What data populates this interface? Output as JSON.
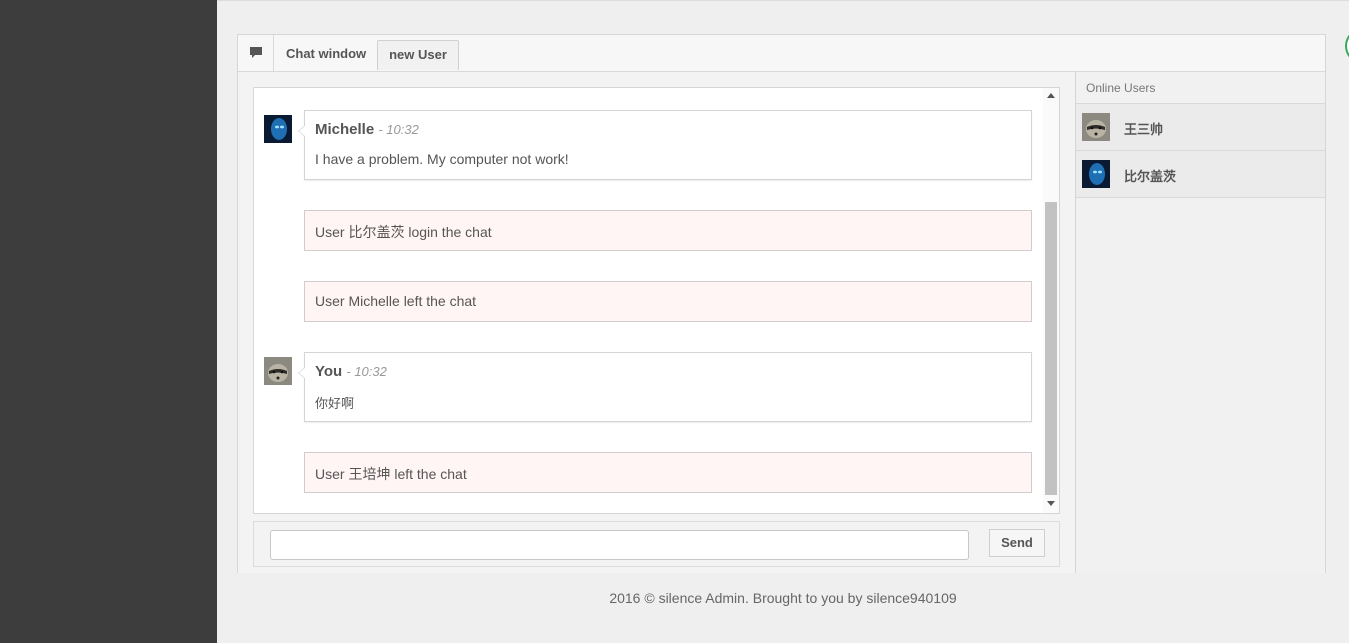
{
  "colors": {
    "sidebar": "#3d3d3d",
    "system_message_bg": "#fff5f5",
    "scroll_thumb": "#c2c2c2"
  },
  "header": {
    "icon": "comment-icon",
    "title": "Chat window",
    "tab_label": "new User"
  },
  "messages": [
    {
      "type": "user",
      "avatar": "blue-avatar-icon",
      "name": "Michelle",
      "time": "- 10:32",
      "text": "I have a problem. My computer not work!"
    },
    {
      "type": "system",
      "text": "User 比尔盖茨 login the chat"
    },
    {
      "type": "system",
      "text": "User Michelle left the chat"
    },
    {
      "type": "user",
      "avatar": "raccoon-avatar-icon",
      "name": "You",
      "time": "- 10:32",
      "text": "你好啊"
    },
    {
      "type": "system",
      "text": "User 王培坤 left the chat"
    }
  ],
  "input": {
    "value": "",
    "placeholder": ""
  },
  "send_label": "Send",
  "online_users": {
    "title": "Online Users",
    "users": [
      {
        "name": "王三帅",
        "avatar": "raccoon-avatar-icon"
      },
      {
        "name": "比尔盖茨",
        "avatar": "blue-avatar-icon"
      }
    ]
  },
  "footer": {
    "text": "2016 © silence Admin. Brought to you by silence940109"
  }
}
